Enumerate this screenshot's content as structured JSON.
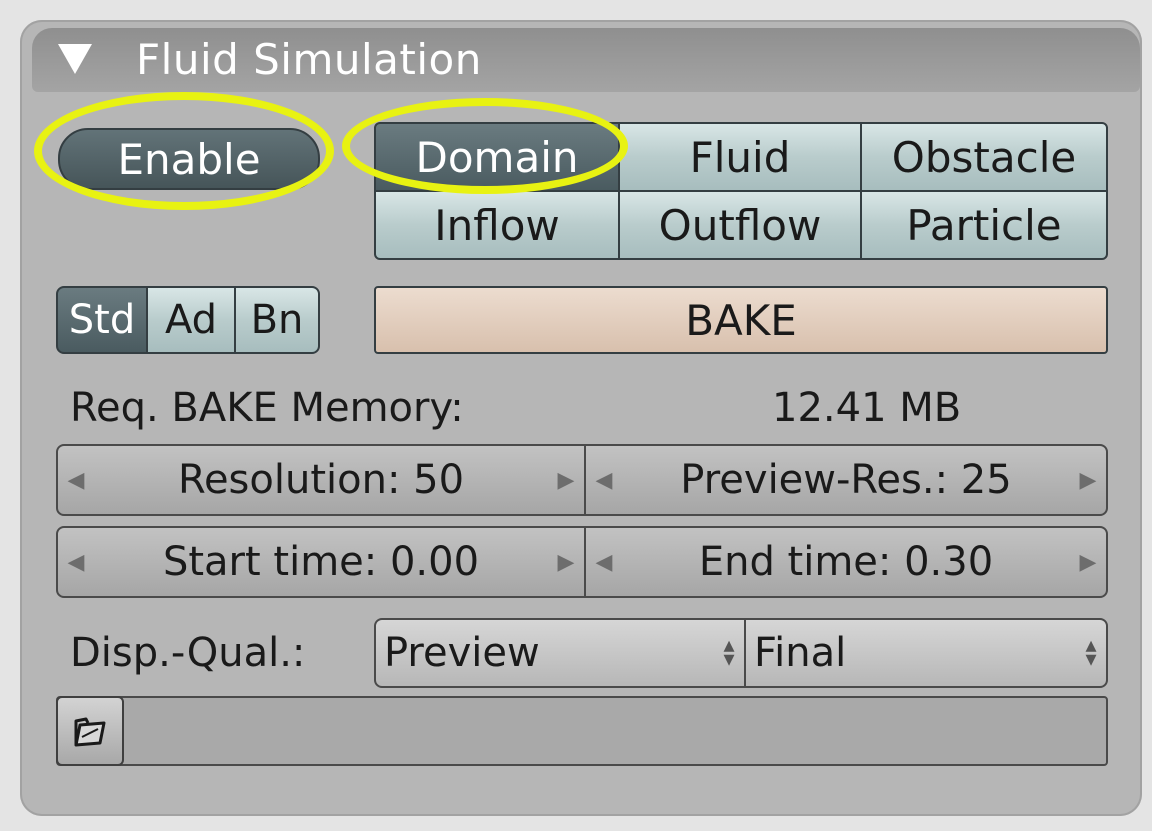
{
  "panel": {
    "title": "Fluid Simulation",
    "collapse_icon": "triangle-down-icon"
  },
  "enable_button": {
    "label": "Enable",
    "highlighted": true
  },
  "type_buttons": [
    {
      "label": "Domain",
      "active": true,
      "highlighted": true
    },
    {
      "label": "Fluid",
      "active": false
    },
    {
      "label": "Obstacle",
      "active": false
    },
    {
      "label": "Inflow",
      "active": false
    },
    {
      "label": "Outflow",
      "active": false
    },
    {
      "label": "Particle",
      "active": false
    }
  ],
  "mode_tabs": [
    {
      "label": "Std",
      "active": true
    },
    {
      "label": "Ad",
      "active": false
    },
    {
      "label": "Bn",
      "active": false
    }
  ],
  "bake_button": {
    "label": "BAKE"
  },
  "memory": {
    "label": "Req. BAKE Memory:",
    "value": "12.41 MB"
  },
  "fields": {
    "resolution": "Resolution: 50",
    "preview_res": "Preview-Res.: 25",
    "start_time": "Start time: 0.00",
    "end_time": "End time: 0.30"
  },
  "display_quality": {
    "label": "Disp.-Qual.:",
    "viewport_value": "Preview",
    "render_value": "Final"
  },
  "file_path": {
    "icon": "folder-icon",
    "value": ""
  },
  "colors": {
    "highlight": "#e8f212",
    "panel": "#b6b6b6",
    "active_button": "#4a5b60",
    "bake_button": "#d8c0ad"
  }
}
